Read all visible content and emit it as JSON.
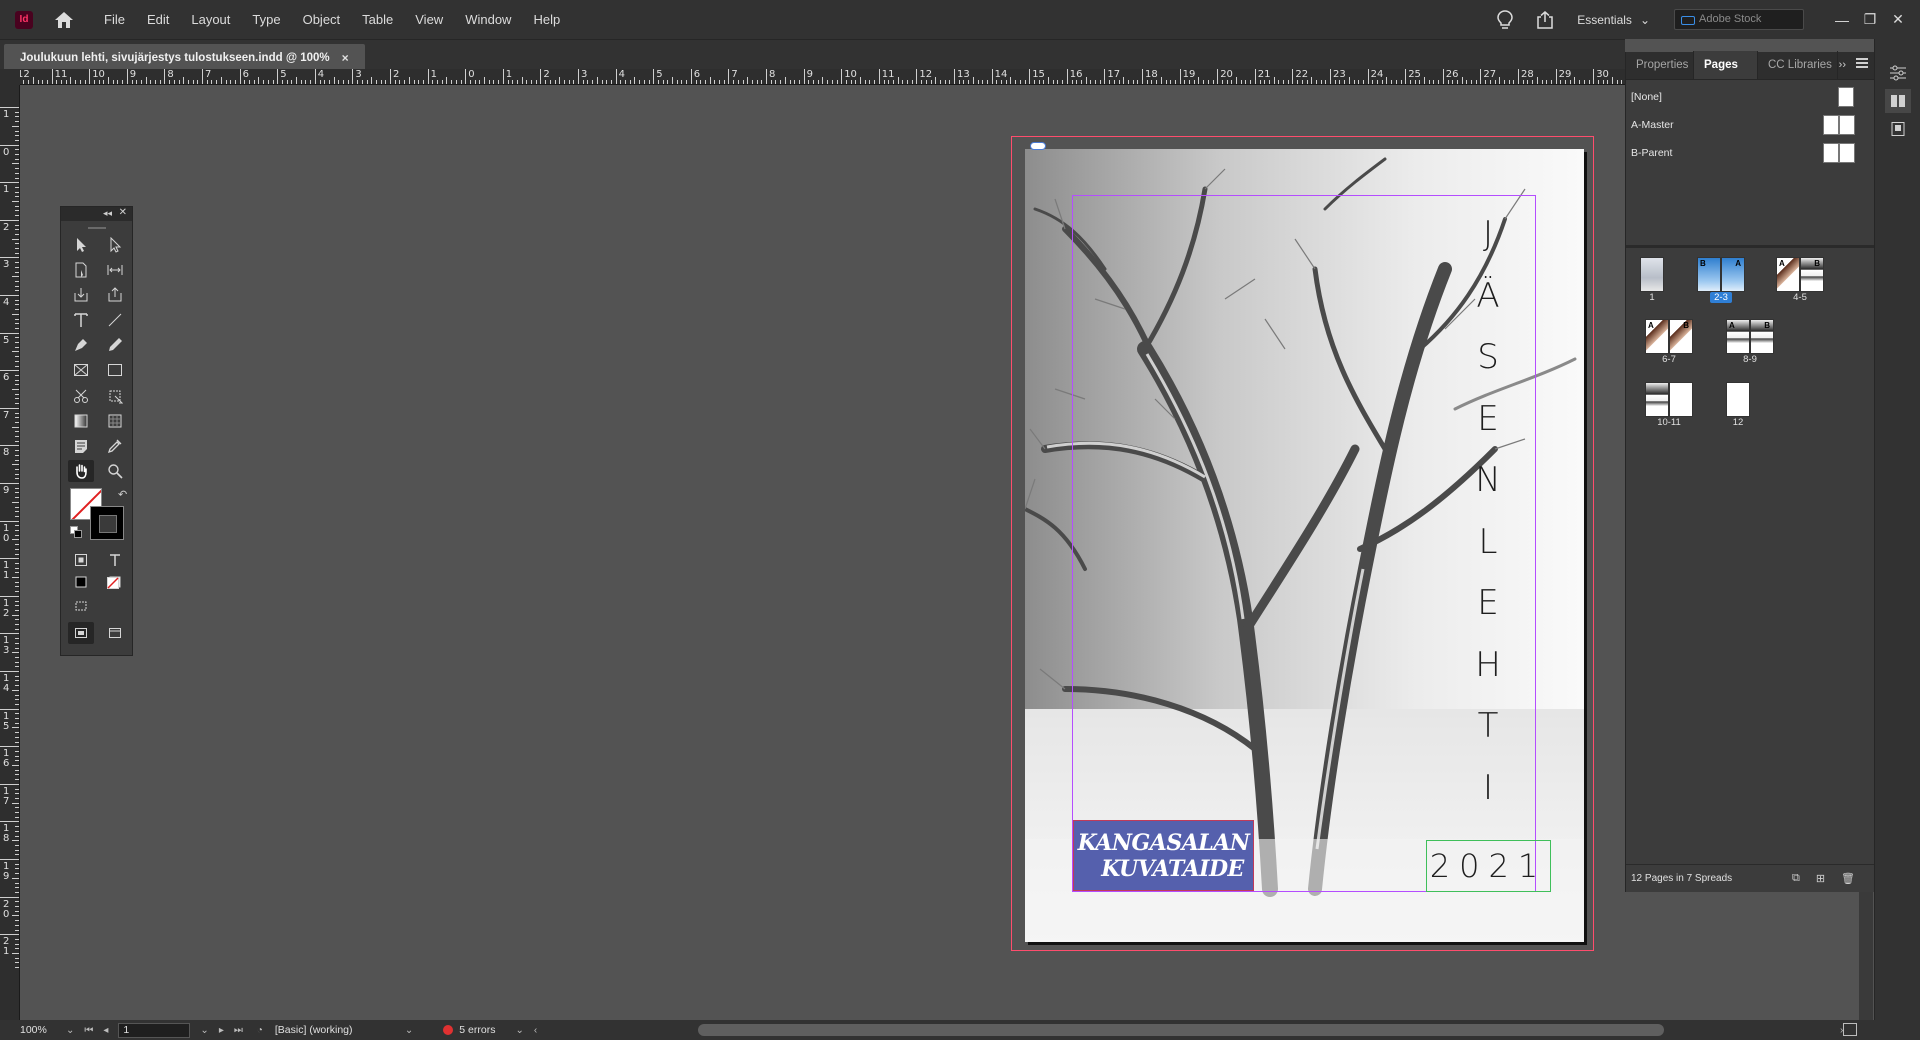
{
  "app": {
    "logo": "Id",
    "menus": [
      "File",
      "Edit",
      "Layout",
      "Type",
      "Object",
      "Table",
      "View",
      "Window",
      "Help"
    ],
    "workspace": "Essentials",
    "stock_search_placeholder": "Adobe Stock",
    "window_controls": {
      "minimize": "—",
      "restore": "❐",
      "close": "✕"
    }
  },
  "document_tab": {
    "title": "Joulukuun lehti, sivujärjestys tulostukseen.indd @ 100%",
    "close": "×"
  },
  "rulers": {
    "top_labels": [
      "12",
      "11",
      "10",
      "9",
      "8",
      "7",
      "6",
      "5",
      "4",
      "3",
      "2",
      "1",
      "0",
      "1",
      "2",
      "3",
      "4",
      "5",
      "6",
      "7",
      "8",
      "9",
      "10",
      "11",
      "12",
      "13",
      "14",
      "15",
      "16",
      "17",
      "18",
      "19",
      "20",
      "21",
      "22",
      "23",
      "24",
      "25",
      "26",
      "27",
      "28",
      "29",
      "30"
    ],
    "left_labels": [
      "1",
      "0",
      "1",
      "2",
      "3",
      "4",
      "5",
      "6",
      "7",
      "8",
      "9",
      "10",
      "11",
      "12",
      "13",
      "14",
      "15",
      "16",
      "17",
      "18",
      "19",
      "20",
      "21"
    ]
  },
  "page": {
    "vertical_title_letters": [
      "J",
      "Ä",
      "S",
      "E",
      "N",
      "L",
      "E",
      "H",
      "T",
      "I"
    ],
    "logo_line1": "KANGASALAN",
    "logo_line2": "KUVATAIDE",
    "year": "2021"
  },
  "panel": {
    "tabs": [
      "Properties",
      "Pages",
      "CC Libraries"
    ],
    "active_tab": "Pages",
    "masters": [
      {
        "label": "[None]"
      },
      {
        "label": "A-Master"
      },
      {
        "label": "B-Parent"
      }
    ],
    "spreads": [
      {
        "label": "1",
        "selected": false
      },
      {
        "label": "2-3",
        "selected": true
      },
      {
        "label": "4-5",
        "selected": false
      },
      {
        "label": "6-7",
        "selected": false
      },
      {
        "label": "8-9",
        "selected": false
      },
      {
        "label": "10-11",
        "selected": false
      },
      {
        "label": "12",
        "selected": false
      }
    ],
    "footer": "12 Pages in 7 Spreads"
  },
  "statusbar": {
    "zoom": "100%",
    "page_number": "1",
    "preflight_profile": "[Basic] (working)",
    "errors": "5 errors"
  },
  "colors": {
    "accent": "#2f7fd6",
    "bleed": "#ff4d6d",
    "margin": "#b44dff",
    "logo_bg": "#5560ad",
    "error": "#e03131"
  }
}
